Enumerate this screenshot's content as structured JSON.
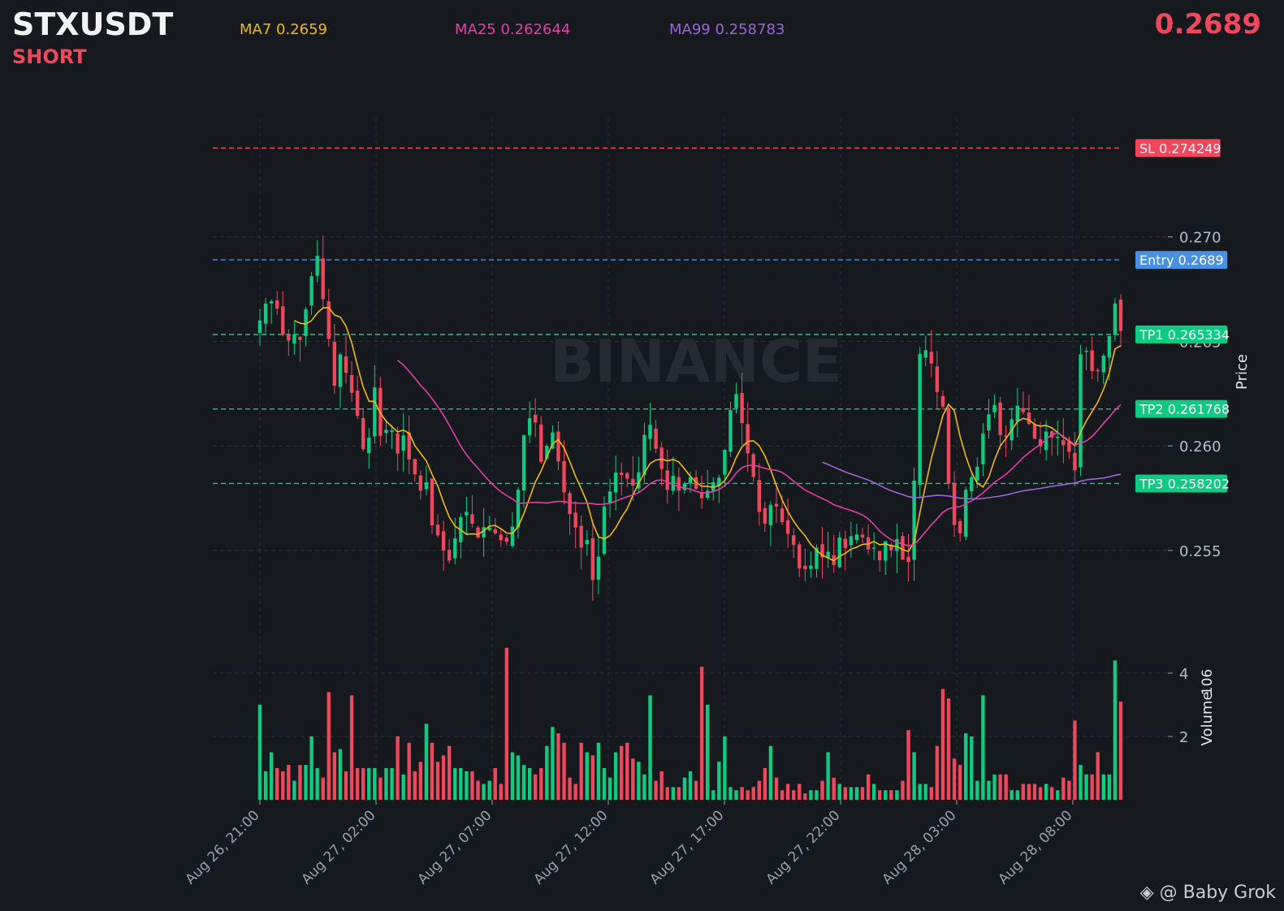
{
  "header": {
    "symbol": "STXUSDT",
    "side": "SHORT",
    "ma7": "MA7 0.2659",
    "ma25": "MA25 0.262644",
    "ma99": "MA99 0.258783",
    "last_price": "0.2689"
  },
  "watermark": "BINANCE",
  "credit": "@ Baby Grok",
  "credit_icon": "binance-diamond-icon",
  "colors": {
    "up": "#0ecb81",
    "down": "#f0475d",
    "ma7": "#f0b90b",
    "ma25": "#e43ea7",
    "ma99": "#9d63d8",
    "entry": "#4a90e2",
    "sl": "#f0475d",
    "tp": "#0ecb81"
  },
  "chart_data": {
    "type": "candlestick",
    "price_ylabel": "Price",
    "volume_ylabel": "Volume",
    "volume_exponent": "6",
    "price_ticks": [
      "0.255",
      "0.260",
      "0.265",
      "0.270"
    ],
    "price_ylim": [
      0.2522,
      0.2757
    ],
    "volume_ticks": [
      "2",
      "4"
    ],
    "volume_ylim": [
      0,
      5
    ],
    "x_ticks": [
      "Aug 26, 21:00",
      "Aug 27, 02:00",
      "Aug 27, 07:00",
      "Aug 27, 12:00",
      "Aug 27, 17:00",
      "Aug 27, 22:00",
      "Aug 28, 03:00",
      "Aug 28, 08:00"
    ],
    "levels": [
      {
        "label": "SL 0.274249",
        "value": 0.274249,
        "kind": "sl"
      },
      {
        "label": "Entry 0.2689",
        "value": 0.2689,
        "kind": "entry"
      },
      {
        "label": "TP1 0.265334",
        "value": 0.265334,
        "kind": "tp"
      },
      {
        "label": "TP2 0.261768",
        "value": 0.261768,
        "kind": "tp"
      },
      {
        "label": "TP3 0.258202",
        "value": 0.258202,
        "kind": "tp"
      }
    ],
    "close_key": [
      0.266,
      0.2668,
      0.2669,
      0.267,
      0.2658,
      0.2648,
      0.2652,
      0.2654,
      0.265,
      0.2666,
      0.268,
      0.2695,
      0.2675,
      0.266,
      0.264,
      0.262,
      0.2655,
      0.263,
      0.2625,
      0.2615,
      0.26,
      0.259,
      0.264,
      0.261,
      0.26,
      0.2612,
      0.2606,
      0.2595,
      0.2605,
      0.2594,
      0.259,
      0.2575,
      0.2585,
      0.258,
      0.255,
      0.256,
      0.2548,
      0.2545,
      0.2555,
      0.2565,
      0.257,
      0.2565,
      0.256,
      0.2553,
      0.2565,
      0.256,
      0.2558,
      0.2555,
      0.2553,
      0.256,
      0.2565,
      0.26,
      0.261,
      0.2615,
      0.261,
      0.259,
      0.26,
      0.2608,
      0.2595,
      0.2585,
      0.2565,
      0.257,
      0.2555,
      0.255,
      0.2556,
      0.2535,
      0.2545,
      0.257,
      0.2575,
      0.2585,
      0.259,
      0.2583,
      0.2585,
      0.258,
      0.2588,
      0.2605,
      0.2612,
      0.26,
      0.2595,
      0.258,
      0.2578,
      0.259,
      0.2575,
      0.2583,
      0.2585,
      0.258,
      0.2575,
      0.2575,
      0.2585,
      0.258,
      0.2588,
      0.2602,
      0.262,
      0.2625,
      0.2612,
      0.2598,
      0.259,
      0.2575,
      0.256,
      0.2565,
      0.2575,
      0.257,
      0.2563,
      0.2558,
      0.2555,
      0.254,
      0.2545,
      0.2535,
      0.255,
      0.2552,
      0.2545,
      0.255,
      0.2543,
      0.2557,
      0.255,
      0.2555,
      0.256,
      0.2555,
      0.2557,
      0.2548,
      0.2552,
      0.2545,
      0.2555,
      0.2548,
      0.2558,
      0.255,
      0.254,
      0.2548,
      0.26,
      0.2655,
      0.2645,
      0.264,
      0.2625,
      0.263,
      0.259,
      0.257,
      0.2555,
      0.256,
      0.2585,
      0.2585,
      0.259,
      0.2605,
      0.2612,
      0.2625,
      0.261,
      0.26,
      0.2607,
      0.2615,
      0.262,
      0.2616,
      0.2611,
      0.2605,
      0.2597,
      0.2606,
      0.2608,
      0.2601,
      0.2606,
      0.2599,
      0.2597,
      0.2586,
      0.2643,
      0.2648,
      0.2639,
      0.2631,
      0.264,
      0.2645,
      0.2655,
      0.267,
      0.2655
    ],
    "volume_key": [
      3.0,
      0.9,
      1.5,
      1.0,
      0.9,
      1.1,
      0.6,
      1.1,
      1.1,
      2.0,
      1.0,
      0.7,
      3.4,
      1.5,
      1.6,
      0.9,
      3.3,
      1.0,
      1.0,
      1.0,
      1.0,
      0.7,
      1.0,
      1.0,
      2.0,
      0.5,
      0.8,
      1.8,
      0.9,
      1.2,
      2.4,
      1.8,
      1.2,
      1.4,
      1.7,
      1.0,
      1.0,
      0.9,
      0.9,
      0.6,
      0.5,
      0.6,
      1.0,
      0.5,
      4.8,
      1.5,
      1.4,
      1.1,
      1.0,
      0.8,
      1.0,
      1.7,
      2.3,
      2.1,
      1.8,
      0.7,
      0.5,
      1.8,
      1.5,
      1.4,
      1.8,
      1.0,
      0.7,
      1.5,
      1.7,
      1.8,
      1.3,
      1.2,
      0.8,
      3.3,
      0.6,
      0.9,
      0.4,
      0.4,
      0.4,
      0.7,
      0.8,
      0.9,
      0.6,
      4.2,
      3.0,
      0.3,
      1.2,
      2.0,
      0.4,
      0.3,
      0.4,
      0.3,
      0.4,
      0.6,
      1.0,
      1.7,
      0.7,
      0.3,
      0.5,
      0.3,
      0.5,
      0.2,
      0.3,
      0.3,
      0.6,
      1.5,
      0.7,
      0.5,
      0.4,
      0.4,
      0.4,
      0.4,
      0.8,
      0.5,
      0.3,
      0.3,
      0.3,
      0.3,
      0.6,
      2.2,
      1.5,
      0.5,
      0.5,
      0.4,
      1.7,
      3.5,
      3.2,
      1.3,
      1.1,
      2.1,
      2.0,
      1.0,
      0.6,
      3.3,
      0.6,
      0.8,
      0.8,
      0.8,
      0.3,
      0.3,
      0.5,
      0.5,
      0.5,
      0.4,
      0.5,
      0.4,
      0.3,
      0.7,
      0.6,
      2.5,
      1.1,
      0.8,
      0.8,
      1.5,
      0.8,
      0.8,
      4.4,
      3.1
    ]
  }
}
